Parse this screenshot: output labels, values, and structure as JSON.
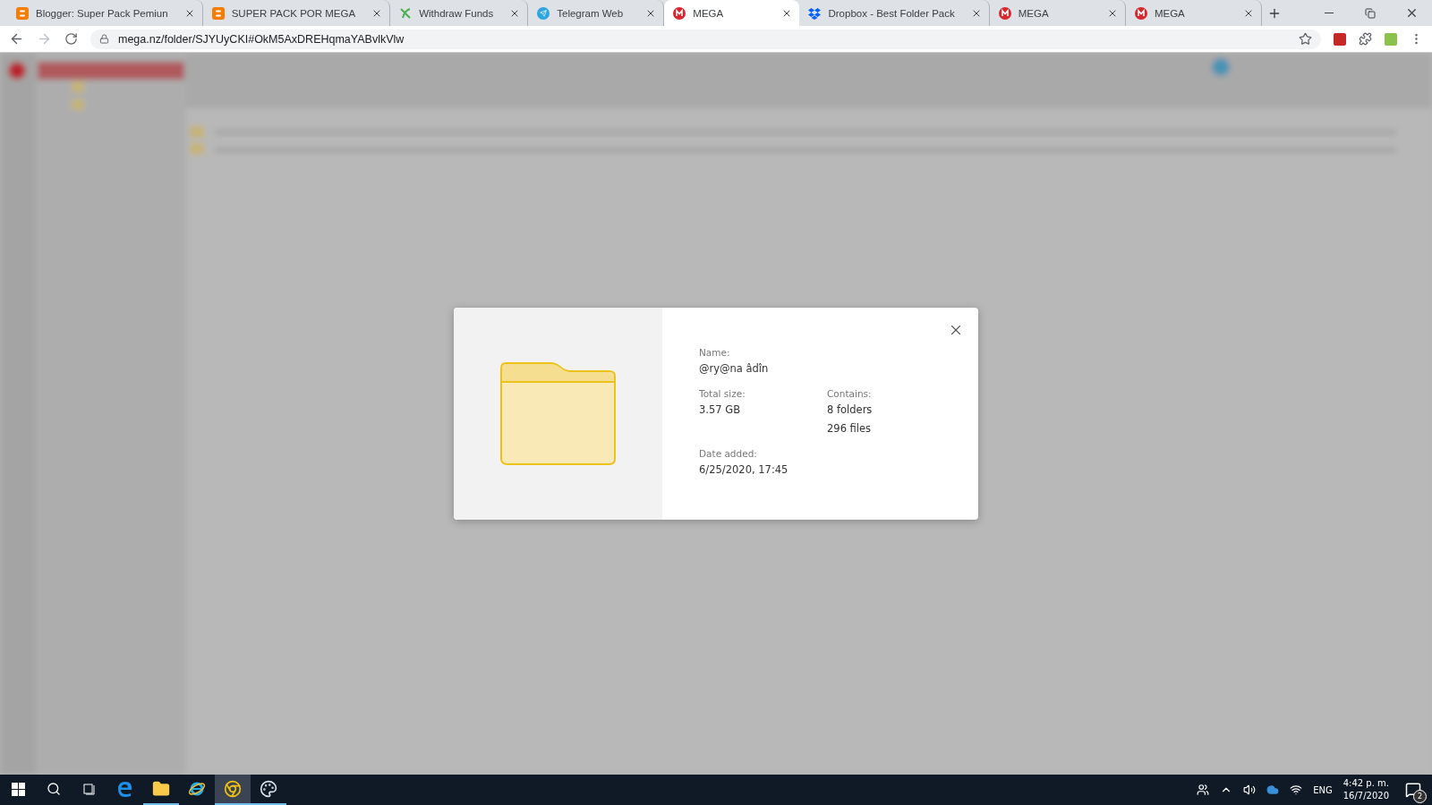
{
  "browser": {
    "tabs": [
      {
        "title": "Blogger: Super Pack Pemiun",
        "kind": "blogger",
        "selected": false
      },
      {
        "title": "SUPER PACK POR MEGA",
        "kind": "blogger",
        "selected": false
      },
      {
        "title": "Withdraw Funds",
        "kind": "withdraw",
        "selected": false
      },
      {
        "title": "Telegram Web",
        "kind": "telegram",
        "selected": false
      },
      {
        "title": "MEGA",
        "kind": "mega",
        "selected": true
      },
      {
        "title": "Dropbox - Best Folder Pack",
        "kind": "dropbox",
        "selected": false
      },
      {
        "title": "MEGA",
        "kind": "mega",
        "selected": false
      },
      {
        "title": "MEGA",
        "kind": "mega",
        "selected": false
      }
    ],
    "address": "mega.nz/folder/SJYUyCKI#OkM5AxDREHqmaYABvlkVlw"
  },
  "dialog": {
    "name": {
      "label": "Name:",
      "value": "@ry@na âdîn"
    },
    "total_size": {
      "label": "Total size:",
      "value": "3.57 GB"
    },
    "contains": {
      "label": "Contains:",
      "values": [
        "8 folders",
        "296 files"
      ]
    },
    "date_added": {
      "label": "Date added:",
      "value": "6/25/2020, 17:45"
    }
  },
  "taskbar": {
    "apps": [
      {
        "kind": "search",
        "running": false,
        "selected": false
      },
      {
        "kind": "taskview",
        "running": false,
        "selected": false
      },
      {
        "kind": "edge",
        "running": false,
        "selected": false
      },
      {
        "kind": "explorer",
        "running": true,
        "selected": false
      },
      {
        "kind": "ie",
        "running": false,
        "selected": false
      },
      {
        "kind": "chrome",
        "running": true,
        "selected": true
      },
      {
        "kind": "paint",
        "running": true,
        "selected": false
      }
    ],
    "tray": {
      "language": "ENG",
      "time": "4:42 p. m.",
      "date": "16/7/2020",
      "notifications": "2"
    }
  }
}
